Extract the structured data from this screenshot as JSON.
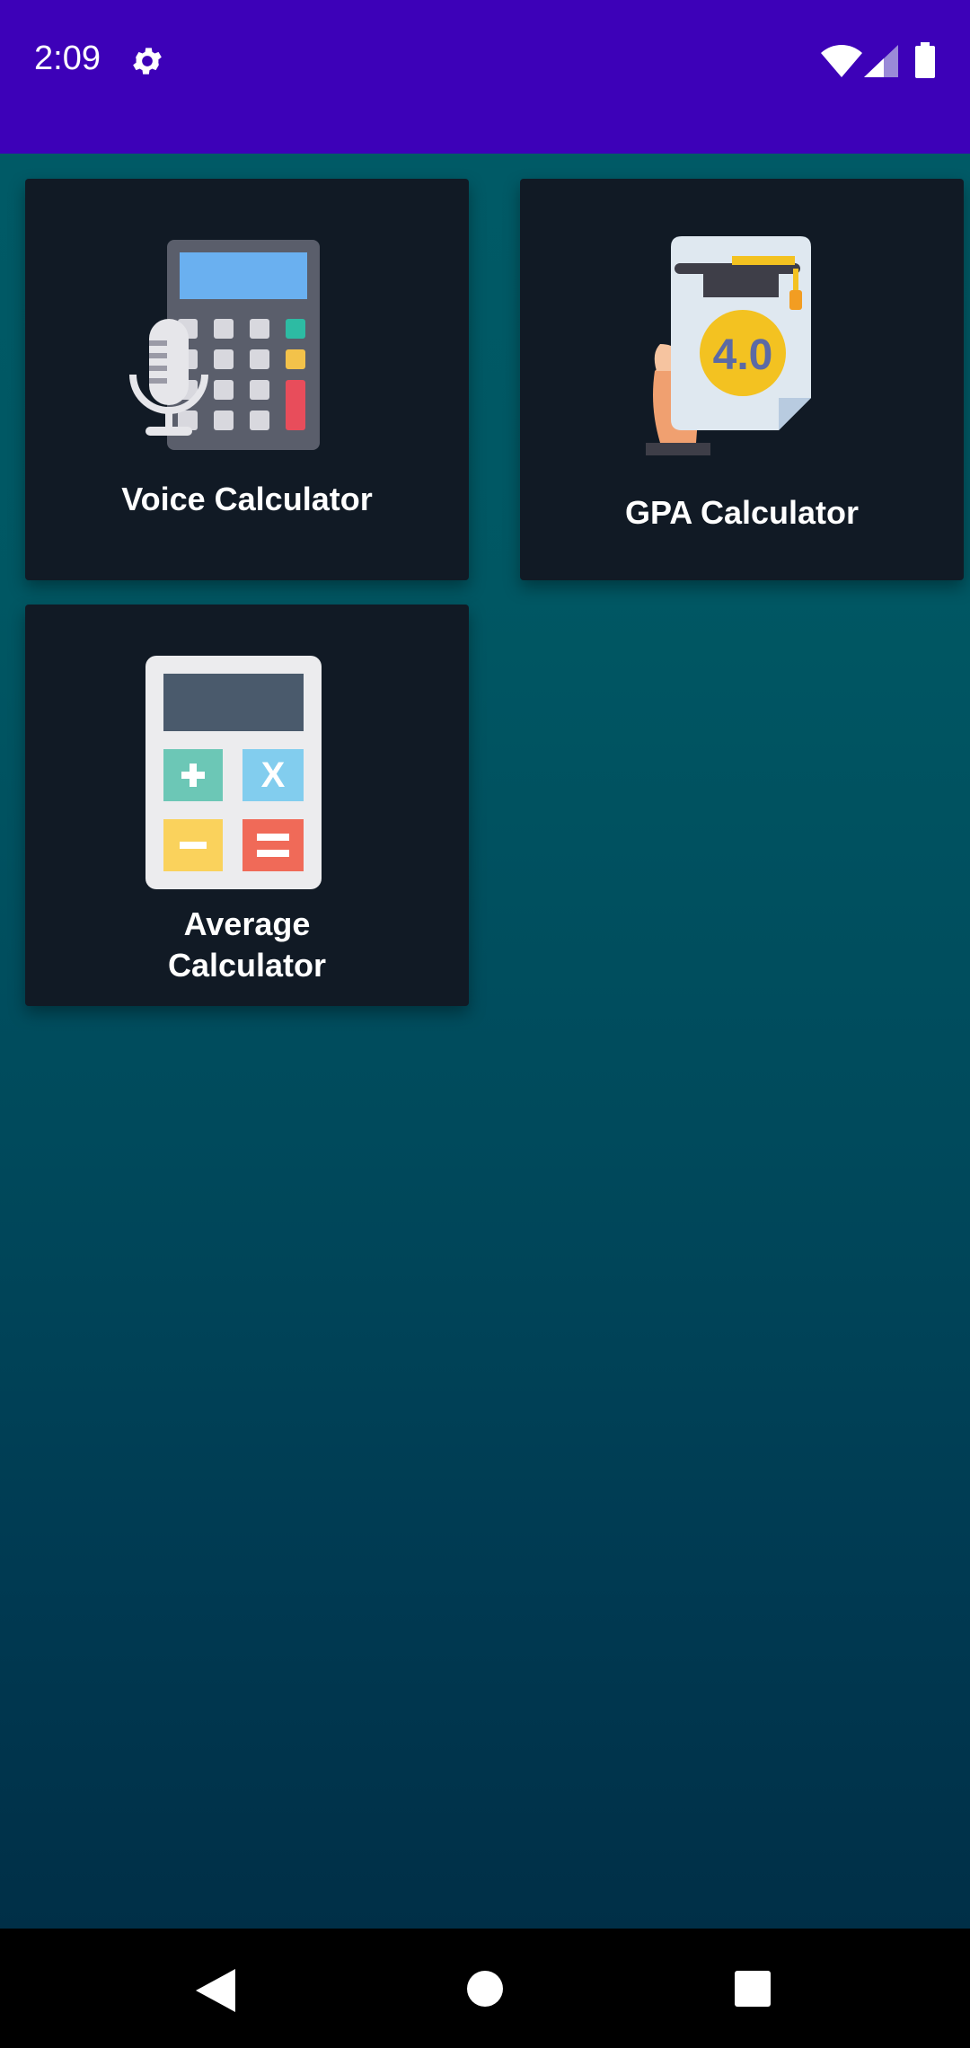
{
  "status_bar": {
    "time": "2:09",
    "icons": [
      "settings-icon",
      "wifi-icon",
      "signal-icon",
      "battery-icon"
    ]
  },
  "cards": [
    {
      "label": "Voice Calculator",
      "icon": "voice-calculator-icon"
    },
    {
      "label": "GPA Calculator",
      "icon": "gpa-certificate-icon"
    },
    {
      "label": "Average Calculator",
      "icon": "calculator-icon"
    }
  ],
  "nav_bar": {
    "buttons": [
      "back-icon",
      "home-icon",
      "recents-icon"
    ]
  },
  "colors": {
    "status_bar": "#3d01b8",
    "card_background": "#111a25",
    "gradient_top": "#005a66",
    "gradient_bottom": "#002f47"
  }
}
